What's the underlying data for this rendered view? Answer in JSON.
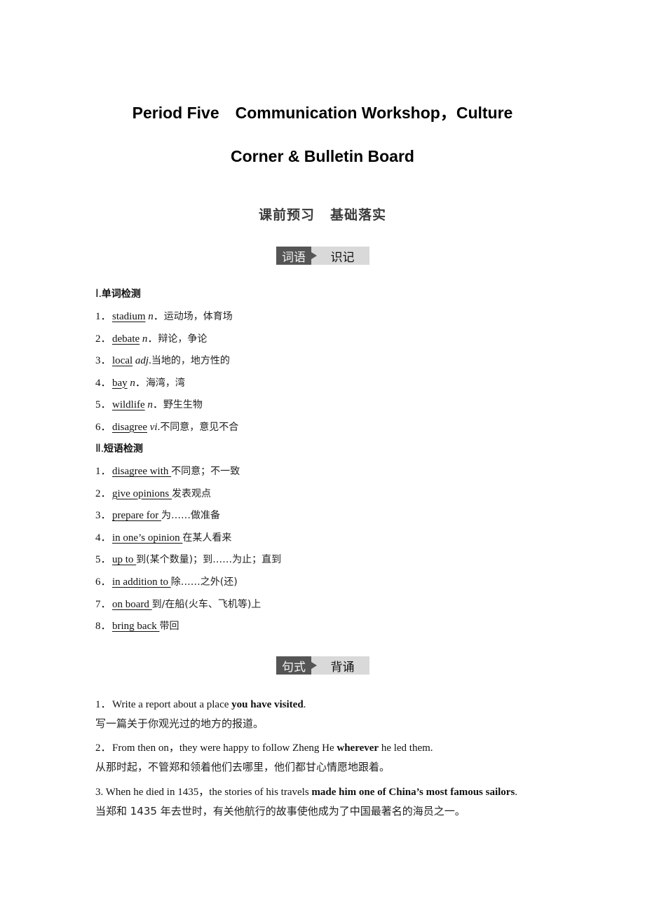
{
  "header": {
    "title_line1": "Period Five　Communication Workshop，Culture",
    "title_line2": "Corner & Bulletin Board",
    "subtitle_left": "课前预习",
    "subtitle_right": "基础落实"
  },
  "banners": [
    {
      "tag": "词语",
      "label": "识记"
    },
    {
      "tag": "句式",
      "label": "背诵"
    }
  ],
  "words_section": {
    "roman": "Ⅰ.",
    "heading": "单词检测",
    "items": [
      {
        "num": "1．",
        "term": "stadium",
        "pos": "n",
        "pos_suffix": "．",
        "meaning": "运动场，体育场"
      },
      {
        "num": "2．",
        "term": "debate",
        "pos": "n",
        "pos_suffix": "．",
        "meaning": "辩论，争论"
      },
      {
        "num": "3．",
        "term": "local",
        "pos": "adj",
        "pos_suffix": ".",
        "meaning": "当地的，地方性的"
      },
      {
        "num": "4．",
        "term": "bay",
        "pos": "n",
        "pos_suffix": "．",
        "meaning": "海湾，湾"
      },
      {
        "num": "5．",
        "term": "wildlife",
        "pos": "n",
        "pos_suffix": "．",
        "meaning": "野生生物"
      },
      {
        "num": "6．",
        "term": "disagree",
        "pos": "vi",
        "pos_suffix": ".",
        "meaning": "不同意，意见不合"
      }
    ]
  },
  "phrases_section": {
    "roman": "Ⅱ.",
    "heading": "短语检测",
    "items": [
      {
        "num": "1．",
        "term": "disagree with ",
        "meaning": "不同意；不一致"
      },
      {
        "num": "2．",
        "term": "give opinions ",
        "meaning": "发表观点"
      },
      {
        "num": "3．",
        "term": "prepare for ",
        "meaning": "为……做准备"
      },
      {
        "num": "4．",
        "term": "in one’s opinion ",
        "meaning": "在某人看来"
      },
      {
        "num": "5．",
        "term": "up to ",
        "meaning": "到(某个数量)；到……为止；直到"
      },
      {
        "num": "6．",
        "term": "in addition to ",
        "meaning": "除……之外(还)"
      },
      {
        "num": "7．",
        "term": "on board ",
        "meaning": "到/在船(火车、飞机等)上"
      },
      {
        "num": "8．",
        "term": "bring back ",
        "meaning": "带回"
      }
    ]
  },
  "sentences_section": {
    "items": [
      {
        "num": "1．",
        "pre": "Write a report about a place ",
        "bold": "you have visited",
        "post": ".",
        "translation": "写一篇关于你观光过的地方的报道。"
      },
      {
        "num": "2．",
        "pre": "From then on，they were happy to follow Zheng He ",
        "bold": "wherever",
        "post": " he led them.",
        "translation": "从那时起，不管郑和领着他们去哪里，他们都甘心情愿地跟着。"
      },
      {
        "num": "3.",
        "pre": " When he died in 1435，the stories of his travels ",
        "bold": "made him one of China’s most famous sailors",
        "post": ".",
        "translation": "当郑和 1435 年去世时，有关他航行的故事使他成为了中国最著名的海员之一。"
      }
    ]
  }
}
